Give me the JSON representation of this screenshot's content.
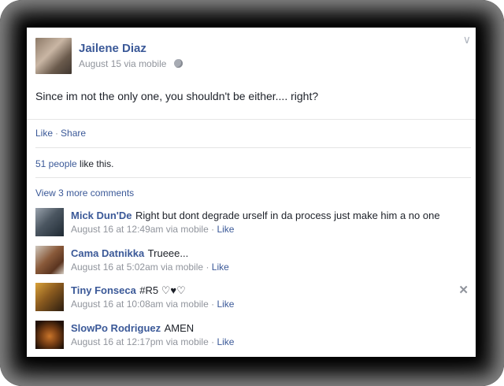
{
  "post": {
    "author": "Jailene Diaz",
    "date": "August 15",
    "via": "via mobile",
    "text": "Since im not the only one, you shouldn't be either.... right?",
    "actions": {
      "like": "Like",
      "share": "Share",
      "separator": "·"
    },
    "likes": {
      "count": "51 people",
      "suffix": " like this."
    },
    "view_more": "View 3 more comments"
  },
  "comments": [
    {
      "name": "Mick Dun'De",
      "text": "Right but dont degrade urself in da process just make him a no one",
      "date": "August 16 at 12:49am via mobile",
      "like": "Like"
    },
    {
      "name": "Cama Datnikka",
      "text": "Trueee...",
      "date": "August 16 at 5:02am via mobile",
      "like": "Like"
    },
    {
      "name": "Tiny Fonseca",
      "text": "#R5 ♡♥♡",
      "date": "August 16 at 10:08am via mobile",
      "like": "Like"
    },
    {
      "name": "SlowPo Rodriguez",
      "text": "AMEN",
      "date": "August 16 at 12:17pm via mobile",
      "like": "Like"
    }
  ],
  "icons": {
    "chevron": "chevron-down-icon",
    "globe": "globe-icon",
    "close": "close-icon"
  },
  "colors": {
    "link": "#3b5998",
    "muted": "#90949c",
    "frame": "#000000"
  }
}
